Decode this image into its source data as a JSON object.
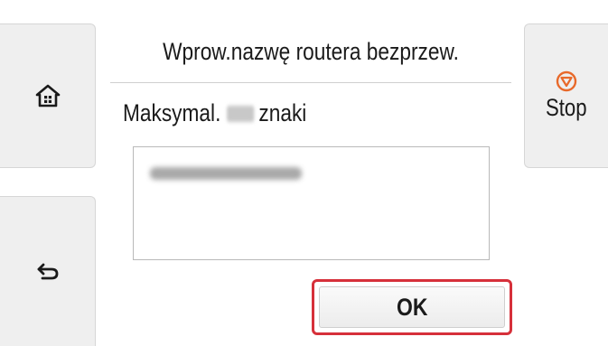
{
  "header": {
    "title": "Wprow.nazwę routera bezprzew."
  },
  "hint": {
    "prefix": "Maksymal.",
    "suffix": "znaki"
  },
  "nav": {
    "home_icon": "home-icon",
    "back_icon": "back-arrow-icon",
    "stop_icon": "stop-icon",
    "stop_label": "Stop"
  },
  "actions": {
    "ok_label": "OK"
  },
  "colors": {
    "highlight": "#d6303a",
    "stop_icon": "#e8692a",
    "panel": "#efefef"
  }
}
